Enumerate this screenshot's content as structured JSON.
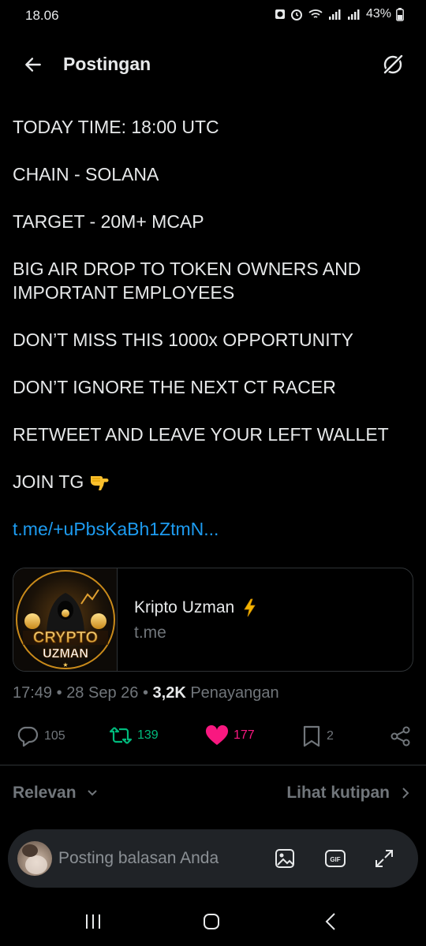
{
  "status_bar": {
    "time": "18.06",
    "battery": "43%"
  },
  "header": {
    "title": "Postingan",
    "back_icon": "arrow-left-icon",
    "grok_icon": "grok-icon"
  },
  "post": {
    "lines": [
      "TODAY TIME: 18:00 UTC",
      "CHAIN - SOLANA",
      "TARGET - 20M+ MCAP",
      "BIG AIR DROP TO TOKEN OWNERS AND\nIMPORTANT EMPLOYEES",
      "DON’T MISS THIS 1000x OPPORTUNITY",
      "DON’T IGNORE THE NEXT CT RACER",
      "RETWEET AND LEAVE YOUR LEFT WALLET"
    ],
    "join_text": "JOIN TG",
    "join_emoji": "backhand-index-pointing-down-icon",
    "link": "t.me/+uPbsKaBh1ZtmN..."
  },
  "card": {
    "title": "Kripto Uzman",
    "title_emoji": "lightning-icon",
    "domain": "t.me",
    "thumb_text_top": "CRYPTO",
    "thumb_text_bottom": "UZMAN"
  },
  "meta": {
    "time": "17:49",
    "date": "28 Sep 26",
    "views": "3,2K",
    "views_label": "Penayangan"
  },
  "actions": {
    "replies": "105",
    "reposts": "139",
    "likes": "177",
    "bookmarks": "2"
  },
  "sort": {
    "label": "Relevan",
    "quotes_label": "Lihat kutipan"
  },
  "reply_bar": {
    "placeholder": "Posting balasan Anda"
  },
  "colors": {
    "background": "#000000",
    "text": "#e7e9ea",
    "muted": "#71767b",
    "link": "#1d9bf0",
    "repost": "#00ba7c",
    "like": "#f91880"
  }
}
